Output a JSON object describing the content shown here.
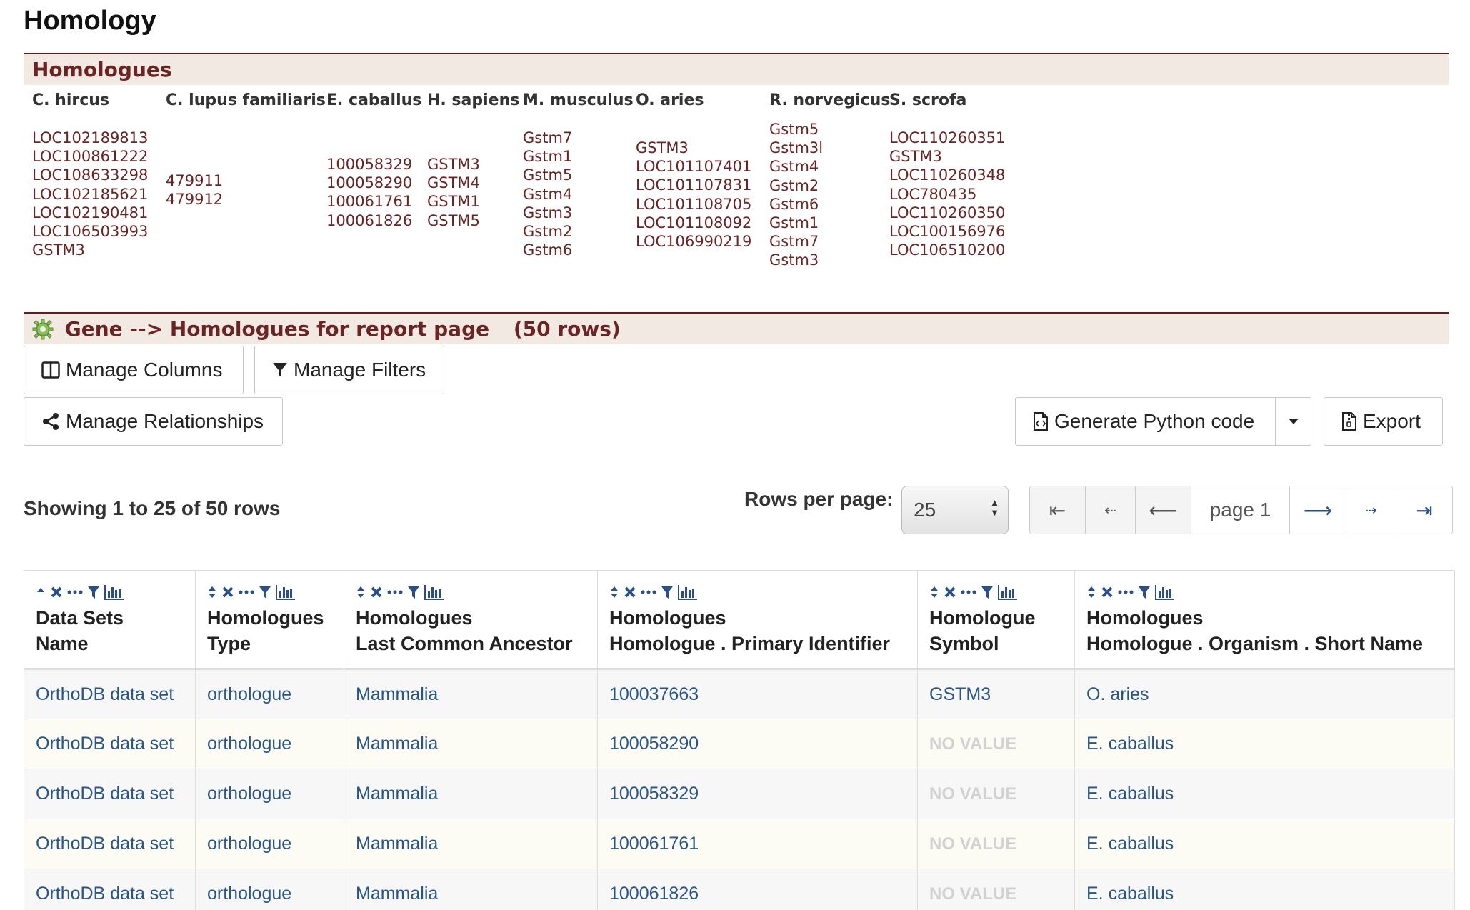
{
  "page_title": "Homology",
  "homologues_section": {
    "title": "Homologues",
    "columns": [
      {
        "organism": "C. hircus",
        "ids": [
          "LOC102189813",
          "LOC100861222",
          "LOC108633298",
          "LOC102185621",
          "LOC102190481",
          "LOC106503993",
          "GSTM3"
        ]
      },
      {
        "organism": "C. lupus familiaris",
        "ids": [
          "479911",
          "479912"
        ]
      },
      {
        "organism": "E. caballus",
        "ids": [
          "100058329",
          "100058290",
          "100061761",
          "100061826"
        ]
      },
      {
        "organism": "H. sapiens",
        "ids": [
          "GSTM3",
          "GSTM4",
          "GSTM1",
          "GSTM5"
        ]
      },
      {
        "organism": "M. musculus",
        "ids": [
          "Gstm7",
          "Gstm1",
          "Gstm5",
          "Gstm4",
          "Gstm3",
          "Gstm2",
          "Gstm6"
        ]
      },
      {
        "organism": "O. aries",
        "ids": [
          "GSTM3",
          "LOC101107401",
          "LOC101107831",
          "LOC101108705",
          "LOC101108092",
          "LOC106990219"
        ]
      },
      {
        "organism": "R. norvegicus",
        "ids": [
          "Gstm5",
          "Gstm3l",
          "Gstm4",
          "Gstm2",
          "Gstm6",
          "Gstm1",
          "Gstm7",
          "Gstm3"
        ]
      },
      {
        "organism": "S. scrofa",
        "ids": [
          "LOC110260351",
          "GSTM3",
          "LOC110260348",
          "LOC780435",
          "LOC110260350",
          "LOC100156976",
          "LOC106510200"
        ]
      }
    ]
  },
  "table_section": {
    "title": "Gene --> Homologues for report page",
    "rows_count": "(50 rows)"
  },
  "toolbar": {
    "manage_columns": "Manage Columns",
    "manage_filters": "Manage Filters",
    "manage_relationships": "Manage Relationships",
    "generate_python": "Generate Python code",
    "export": "Export"
  },
  "pagination": {
    "showing": "Showing 1 to 25 of 50 rows",
    "rows_per_page_label": "Rows per page:",
    "rows_per_page_value": "25",
    "page_indicator": "page 1",
    "buttons": {
      "first": "⇤",
      "prev_big": "⇠",
      "prev": "⟵",
      "next": "⟶",
      "next_big": "⇢",
      "last": "⇥"
    }
  },
  "table": {
    "headers": [
      {
        "line1": "Data Sets",
        "line2": "Name",
        "sort": "asc"
      },
      {
        "line1": "Homologues",
        "line2": "Type",
        "sort": "none"
      },
      {
        "line1": "Homologues",
        "line2": "Last Common Ancestor",
        "sort": "none"
      },
      {
        "line1": "Homologues",
        "line2": "Homologue . Primary Identifier",
        "sort": "none"
      },
      {
        "line1": "Homologue",
        "line2": "Symbol",
        "sort": "none"
      },
      {
        "line1": "Homologues",
        "line2": "Homologue . Organism . Short Name",
        "sort": "none"
      }
    ],
    "rows": [
      [
        "OrthoDB data set",
        "orthologue",
        "Mammalia",
        "100037663",
        "GSTM3",
        "O. aries"
      ],
      [
        "OrthoDB data set",
        "orthologue",
        "Mammalia",
        "100058290",
        "NO VALUE",
        "E. caballus"
      ],
      [
        "OrthoDB data set",
        "orthologue",
        "Mammalia",
        "100058329",
        "NO VALUE",
        "E. caballus"
      ],
      [
        "OrthoDB data set",
        "orthologue",
        "Mammalia",
        "100061761",
        "NO VALUE",
        "E. caballus"
      ],
      [
        "OrthoDB data set",
        "orthologue",
        "Mammalia",
        "100061826",
        "NO VALUE",
        "E. caballus"
      ]
    ]
  },
  "colors": {
    "section_title": "#6b2424",
    "section_bg": "#f3e9e3",
    "link": "#2a5587",
    "no_value": "#d2d2d2"
  }
}
